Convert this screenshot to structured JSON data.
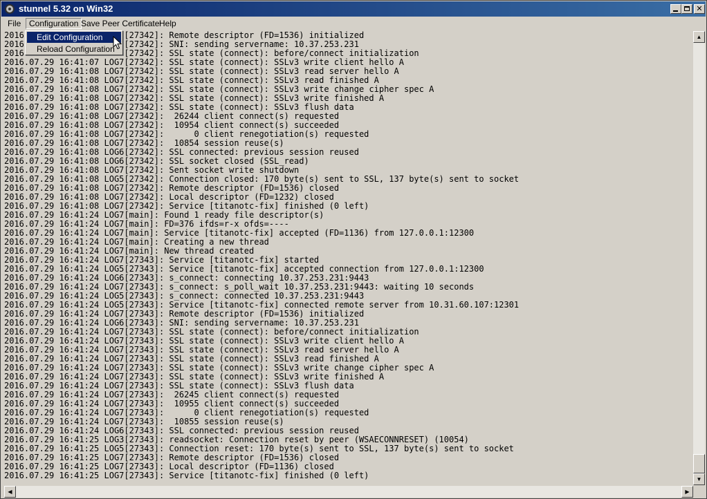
{
  "window": {
    "title": "stunnel 5.32 on Win32",
    "controls": {
      "minimize": "",
      "maximize": "",
      "close": "✕"
    }
  },
  "menubar": {
    "items": [
      "File",
      "Configuration",
      "Save Peer Certificate",
      "Help"
    ]
  },
  "config_menu": {
    "items": [
      "Edit Configuration",
      "Reload Configuration"
    ]
  },
  "log": {
    "lines": [
      "2016.07.29 16:41:07 LOG7[27342]: Remote descriptor (FD=1536) initialized",
      "2016.07.29 16:41:07 LOG6[27342]: SNI: sending servername: 10.37.253.231",
      "2016.07.29 16:41:07 LOG7[27342]: SSL state (connect): before/connect initialization",
      "2016.07.29 16:41:07 LOG7[27342]: SSL state (connect): SSLv3 write client hello A",
      "2016.07.29 16:41:08 LOG7[27342]: SSL state (connect): SSLv3 read server hello A",
      "2016.07.29 16:41:08 LOG7[27342]: SSL state (connect): SSLv3 read finished A",
      "2016.07.29 16:41:08 LOG7[27342]: SSL state (connect): SSLv3 write change cipher spec A",
      "2016.07.29 16:41:08 LOG7[27342]: SSL state (connect): SSLv3 write finished A",
      "2016.07.29 16:41:08 LOG7[27342]: SSL state (connect): SSLv3 flush data",
      "2016.07.29 16:41:08 LOG7[27342]:  26244 client connect(s) requested",
      "2016.07.29 16:41:08 LOG7[27342]:  10954 client connect(s) succeeded",
      "2016.07.29 16:41:08 LOG7[27342]:      0 client renegotiation(s) requested",
      "2016.07.29 16:41:08 LOG7[27342]:  10854 session reuse(s)",
      "2016.07.29 16:41:08 LOG6[27342]: SSL connected: previous session reused",
      "2016.07.29 16:41:08 LOG6[27342]: SSL socket closed (SSL_read)",
      "2016.07.29 16:41:08 LOG7[27342]: Sent socket write shutdown",
      "2016.07.29 16:41:08 LOG5[27342]: Connection closed: 170 byte(s) sent to SSL, 137 byte(s) sent to socket",
      "2016.07.29 16:41:08 LOG7[27342]: Remote descriptor (FD=1536) closed",
      "2016.07.29 16:41:08 LOG7[27342]: Local descriptor (FD=1232) closed",
      "2016.07.29 16:41:08 LOG7[27342]: Service [titanotc-fix] finished (0 left)",
      "2016.07.29 16:41:24 LOG7[main]: Found 1 ready file descriptor(s)",
      "2016.07.29 16:41:24 LOG7[main]: FD=376 ifds=r-x ofds=----",
      "2016.07.29 16:41:24 LOG7[main]: Service [titanotc-fix] accepted (FD=1136) from 127.0.0.1:12300",
      "2016.07.29 16:41:24 LOG7[main]: Creating a new thread",
      "2016.07.29 16:41:24 LOG7[main]: New thread created",
      "2016.07.29 16:41:24 LOG7[27343]: Service [titanotc-fix] started",
      "2016.07.29 16:41:24 LOG5[27343]: Service [titanotc-fix] accepted connection from 127.0.0.1:12300",
      "2016.07.29 16:41:24 LOG6[27343]: s_connect: connecting 10.37.253.231:9443",
      "2016.07.29 16:41:24 LOG7[27343]: s_connect: s_poll_wait 10.37.253.231:9443: waiting 10 seconds",
      "2016.07.29 16:41:24 LOG5[27343]: s_connect: connected 10.37.253.231:9443",
      "2016.07.29 16:41:24 LOG5[27343]: Service [titanotc-fix] connected remote server from 10.31.60.107:12301",
      "2016.07.29 16:41:24 LOG7[27343]: Remote descriptor (FD=1536) initialized",
      "2016.07.29 16:41:24 LOG6[27343]: SNI: sending servername: 10.37.253.231",
      "2016.07.29 16:41:24 LOG7[27343]: SSL state (connect): before/connect initialization",
      "2016.07.29 16:41:24 LOG7[27343]: SSL state (connect): SSLv3 write client hello A",
      "2016.07.29 16:41:24 LOG7[27343]: SSL state (connect): SSLv3 read server hello A",
      "2016.07.29 16:41:24 LOG7[27343]: SSL state (connect): SSLv3 read finished A",
      "2016.07.29 16:41:24 LOG7[27343]: SSL state (connect): SSLv3 write change cipher spec A",
      "2016.07.29 16:41:24 LOG7[27343]: SSL state (connect): SSLv3 write finished A",
      "2016.07.29 16:41:24 LOG7[27343]: SSL state (connect): SSLv3 flush data",
      "2016.07.29 16:41:24 LOG7[27343]:  26245 client connect(s) requested",
      "2016.07.29 16:41:24 LOG7[27343]:  10955 client connect(s) succeeded",
      "2016.07.29 16:41:24 LOG7[27343]:      0 client renegotiation(s) requested",
      "2016.07.29 16:41:24 LOG7[27343]:  10855 session reuse(s)",
      "2016.07.29 16:41:24 LOG6[27343]: SSL connected: previous session reused",
      "2016.07.29 16:41:25 LOG3[27343]: readsocket: Connection reset by peer (WSAECONNRESET) (10054)",
      "2016.07.29 16:41:25 LOG5[27343]: Connection reset: 170 byte(s) sent to SSL, 137 byte(s) sent to socket",
      "2016.07.29 16:41:25 LOG7[27343]: Remote descriptor (FD=1536) closed",
      "2016.07.29 16:41:25 LOG7[27343]: Local descriptor (FD=1136) closed",
      "2016.07.29 16:41:25 LOG7[27343]: Service [titanotc-fix] finished (0 left)"
    ]
  },
  "scrollbars": {
    "up": "▲",
    "down": "▼",
    "left": "◀",
    "right": "▶"
  }
}
